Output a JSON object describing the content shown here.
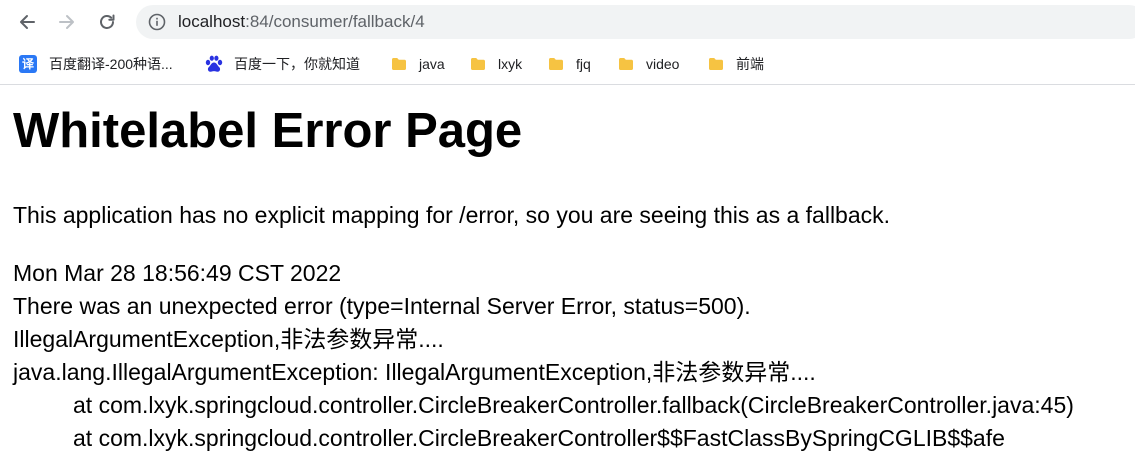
{
  "browser": {
    "url_host": "localhost",
    "url_rest": ":84/consumer/fallback/4",
    "bookmarks": [
      {
        "label": "百度翻译-200种语...",
        "icon": "translate-icon"
      },
      {
        "label": "百度一下，你就知道",
        "icon": "baidu-paw-icon"
      },
      {
        "label": "java",
        "icon": "folder-icon"
      },
      {
        "label": "lxyk",
        "icon": "folder-icon"
      },
      {
        "label": "fjq",
        "icon": "folder-icon"
      },
      {
        "label": "video",
        "icon": "folder-icon"
      },
      {
        "label": "前端",
        "icon": "folder-icon"
      }
    ],
    "translate_glyph": "译"
  },
  "page": {
    "title": "Whitelabel Error Page",
    "description": "This application has no explicit mapping for /error, so you are seeing this as a fallback.",
    "timestamp": "Mon Mar 28 18:56:49 CST 2022",
    "error_line": "There was an unexpected error (type=Internal Server Error, status=500).",
    "message": "IllegalArgumentException,非法参数异常....",
    "exception": "java.lang.IllegalArgumentException: IllegalArgumentException,非法参数异常....",
    "stack": [
      "at com.lxyk.springcloud.controller.CircleBreakerController.fallback(CircleBreakerController.java:45)",
      "at com.lxyk.springcloud.controller.CircleBreakerController$$FastClassBySpringCGLIB$$afe"
    ]
  },
  "colors": {
    "folder": "#f6c342",
    "omnibox": "#f1f3f4",
    "icon_gray": "#5f6368"
  }
}
